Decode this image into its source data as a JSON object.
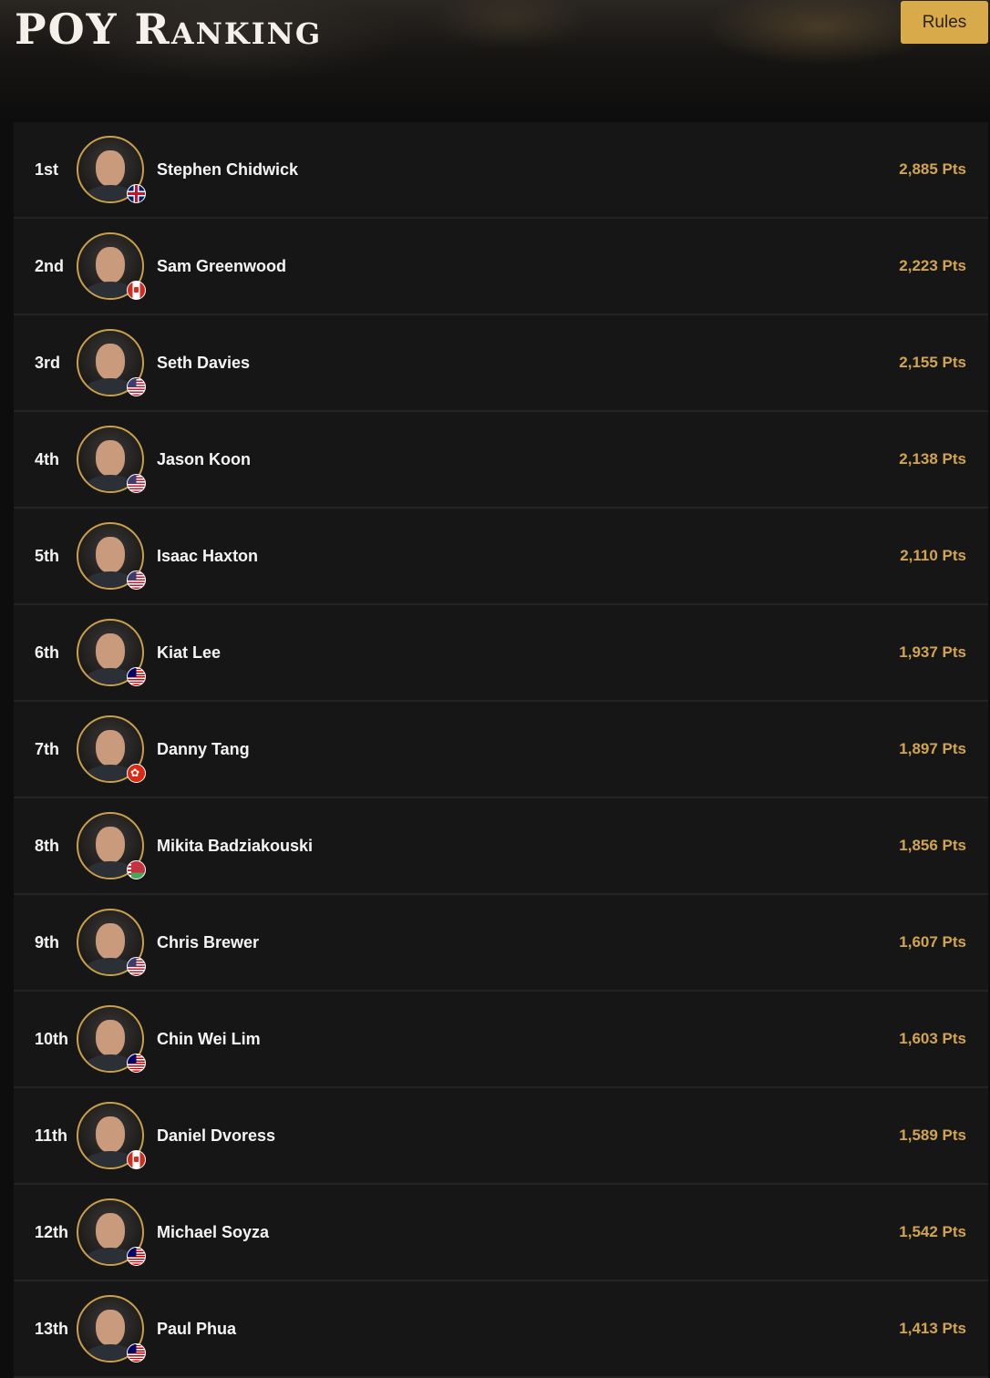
{
  "header": {
    "title": "POY Ranking",
    "rules_label": "Rules"
  },
  "colors": {
    "accent": "#d8aa49",
    "points": "#d2a54c",
    "row_bg": "#161616"
  },
  "rankings": [
    {
      "rank": "1st",
      "name": "Stephen Chidwick",
      "points": "2,885 Pts",
      "flag": "gb"
    },
    {
      "rank": "2nd",
      "name": "Sam Greenwood",
      "points": "2,223 Pts",
      "flag": "ca"
    },
    {
      "rank": "3rd",
      "name": "Seth Davies",
      "points": "2,155 Pts",
      "flag": "us"
    },
    {
      "rank": "4th",
      "name": "Jason Koon",
      "points": "2,138 Pts",
      "flag": "us"
    },
    {
      "rank": "5th",
      "name": "Isaac Haxton",
      "points": "2,110 Pts",
      "flag": "us"
    },
    {
      "rank": "6th",
      "name": "Kiat Lee",
      "points": "1,937 Pts",
      "flag": "my"
    },
    {
      "rank": "7th",
      "name": "Danny Tang",
      "points": "1,897 Pts",
      "flag": "hk"
    },
    {
      "rank": "8th",
      "name": "Mikita Badziakouski",
      "points": "1,856 Pts",
      "flag": "by"
    },
    {
      "rank": "9th",
      "name": "Chris Brewer",
      "points": "1,607 Pts",
      "flag": "us"
    },
    {
      "rank": "10th",
      "name": "Chin Wei Lim",
      "points": "1,603 Pts",
      "flag": "my"
    },
    {
      "rank": "11th",
      "name": "Daniel Dvoress",
      "points": "1,589 Pts",
      "flag": "ca"
    },
    {
      "rank": "12th",
      "name": "Michael Soyza",
      "points": "1,542 Pts",
      "flag": "my"
    },
    {
      "rank": "13th",
      "name": "Paul Phua",
      "points": "1,413 Pts",
      "flag": "my"
    }
  ]
}
